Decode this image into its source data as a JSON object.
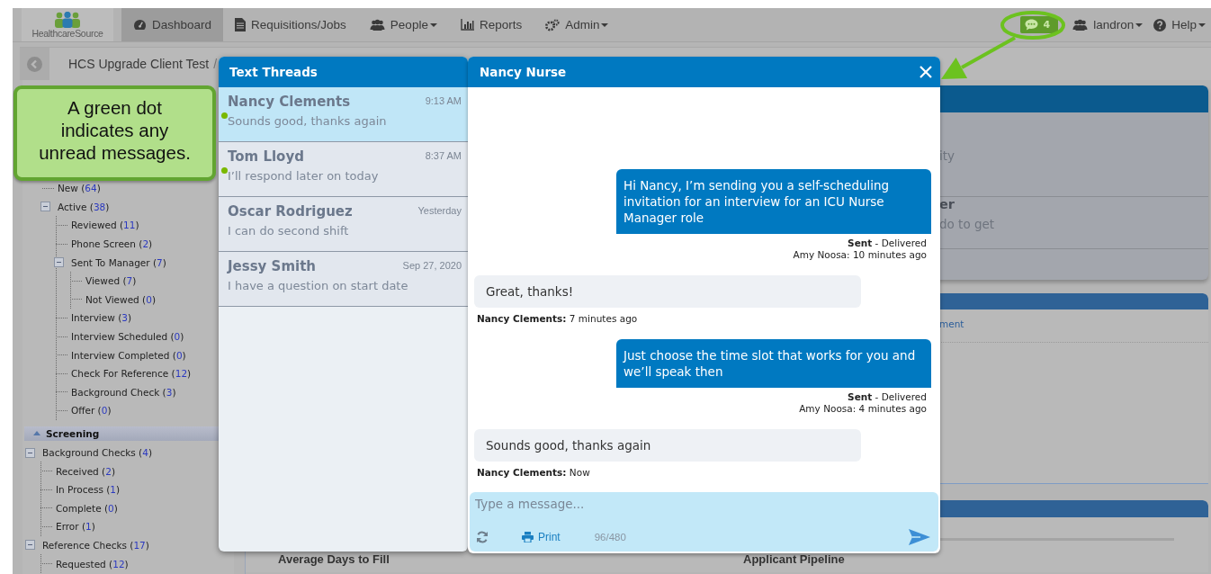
{
  "nav": {
    "logo": "HealthcareSource",
    "items": [
      {
        "label": "Dashboard",
        "selected": true,
        "dropdown": false
      },
      {
        "label": "Requisitions/Jobs",
        "selected": false,
        "dropdown": false
      },
      {
        "label": "People",
        "selected": false,
        "dropdown": true
      },
      {
        "label": "Reports",
        "selected": false,
        "dropdown": false
      },
      {
        "label": "Admin",
        "selected": false,
        "dropdown": true
      }
    ],
    "messages_badge": "4",
    "user": {
      "label": "landron",
      "dropdown": true
    },
    "help": {
      "label": "Help",
      "dropdown": true
    }
  },
  "breadcrumb": {
    "items": [
      "HCS Upgrade Client Test"
    ],
    "separator": "/"
  },
  "sidebar": {
    "groups": [
      {
        "items": [
          {
            "label": "New",
            "count": "(64)"
          },
          {
            "label": "Active",
            "count": "(38)",
            "expanded": true,
            "children": [
              {
                "label": "Reviewed",
                "count": "(11)"
              },
              {
                "label": "Phone Screen",
                "count": "(2)"
              },
              {
                "label": "Sent To Manager",
                "count": "(7)",
                "expanded": true,
                "children": [
                  {
                    "label": "Viewed",
                    "count": "(7)"
                  },
                  {
                    "label": "Not Viewed",
                    "count": "(0)"
                  }
                ]
              },
              {
                "label": "Interview",
                "count": "(3)"
              },
              {
                "label": "Interview Scheduled",
                "count": "(0)"
              },
              {
                "label": "Interview Completed",
                "count": "(0)"
              },
              {
                "label": "Check For Reference",
                "count": "(12)"
              },
              {
                "label": "Background Check",
                "count": "(3)"
              },
              {
                "label": "Offer",
                "count": "(0)"
              }
            ]
          }
        ]
      },
      {
        "title": "Screening",
        "expanded": true,
        "items": [
          {
            "label": "Background Checks",
            "count": "(4)",
            "expanded": true,
            "children": [
              {
                "label": "Received",
                "count": "(2)"
              },
              {
                "label": "In Process",
                "count": "(1)"
              },
              {
                "label": "Complete",
                "count": "(0)"
              },
              {
                "label": "Error",
                "count": "(1)"
              }
            ]
          },
          {
            "label": "Reference Checks",
            "count": "(17)",
            "expanded": true,
            "children": [
              {
                "label": "Requested",
                "count": "(12)"
              }
            ]
          }
        ]
      }
    ]
  },
  "dashboard": {
    "panel_1": {
      "line_1": "ity",
      "heading": "er",
      "line_2": "do to get"
    },
    "panel_2": {
      "link": "ment"
    },
    "panel_3": {
      "titles": [
        "Average Days to Fill",
        "Applicant Pipeline"
      ]
    }
  },
  "callout": {
    "text": "A green dot indicates any unread messages."
  },
  "threads": {
    "title": "Text Threads",
    "items": [
      {
        "name": "Nancy Clements",
        "time": "9:13 AM",
        "preview": "Sounds good, thanks again",
        "selected": true,
        "unread": true
      },
      {
        "name": "Tom Lloyd",
        "time": "8:37 AM",
        "preview": "I’ll respond later on today",
        "selected": false,
        "unread": true
      },
      {
        "name": "Oscar Rodriguez",
        "time": "Yesterday",
        "preview": "I can do second shift",
        "selected": false,
        "unread": false
      },
      {
        "name": "Jessy Smith",
        "time": "Sep 27, 2020",
        "preview": "I have a question on start date",
        "selected": false,
        "unread": false
      }
    ]
  },
  "chat": {
    "title": "Nancy Nurse",
    "messages": [
      {
        "kind": "outgoing",
        "text": "Hi Nancy, I’m sending you a self-scheduling invitation for an interview for an ICU Nurse Manager role",
        "status": "**Sent** - Delivered",
        "meta": "Amy Noosa: 10 minutes ago"
      },
      {
        "kind": "incoming",
        "text": "Great, thanks!",
        "meta": "**Nancy Clements:** 7 minutes ago"
      },
      {
        "kind": "outgoing",
        "text": "Just choose the time slot that works for you and we’ll speak then",
        "status": "**Sent** - Delivered",
        "meta": "Amy Noosa: 4 minutes ago"
      },
      {
        "kind": "incoming",
        "text": "Sounds good, thanks again",
        "meta": "**Nancy Clements:** Now"
      }
    ],
    "compose": {
      "placeholder": "Type a message...",
      "print": "Print",
      "count": "96/480"
    }
  }
}
